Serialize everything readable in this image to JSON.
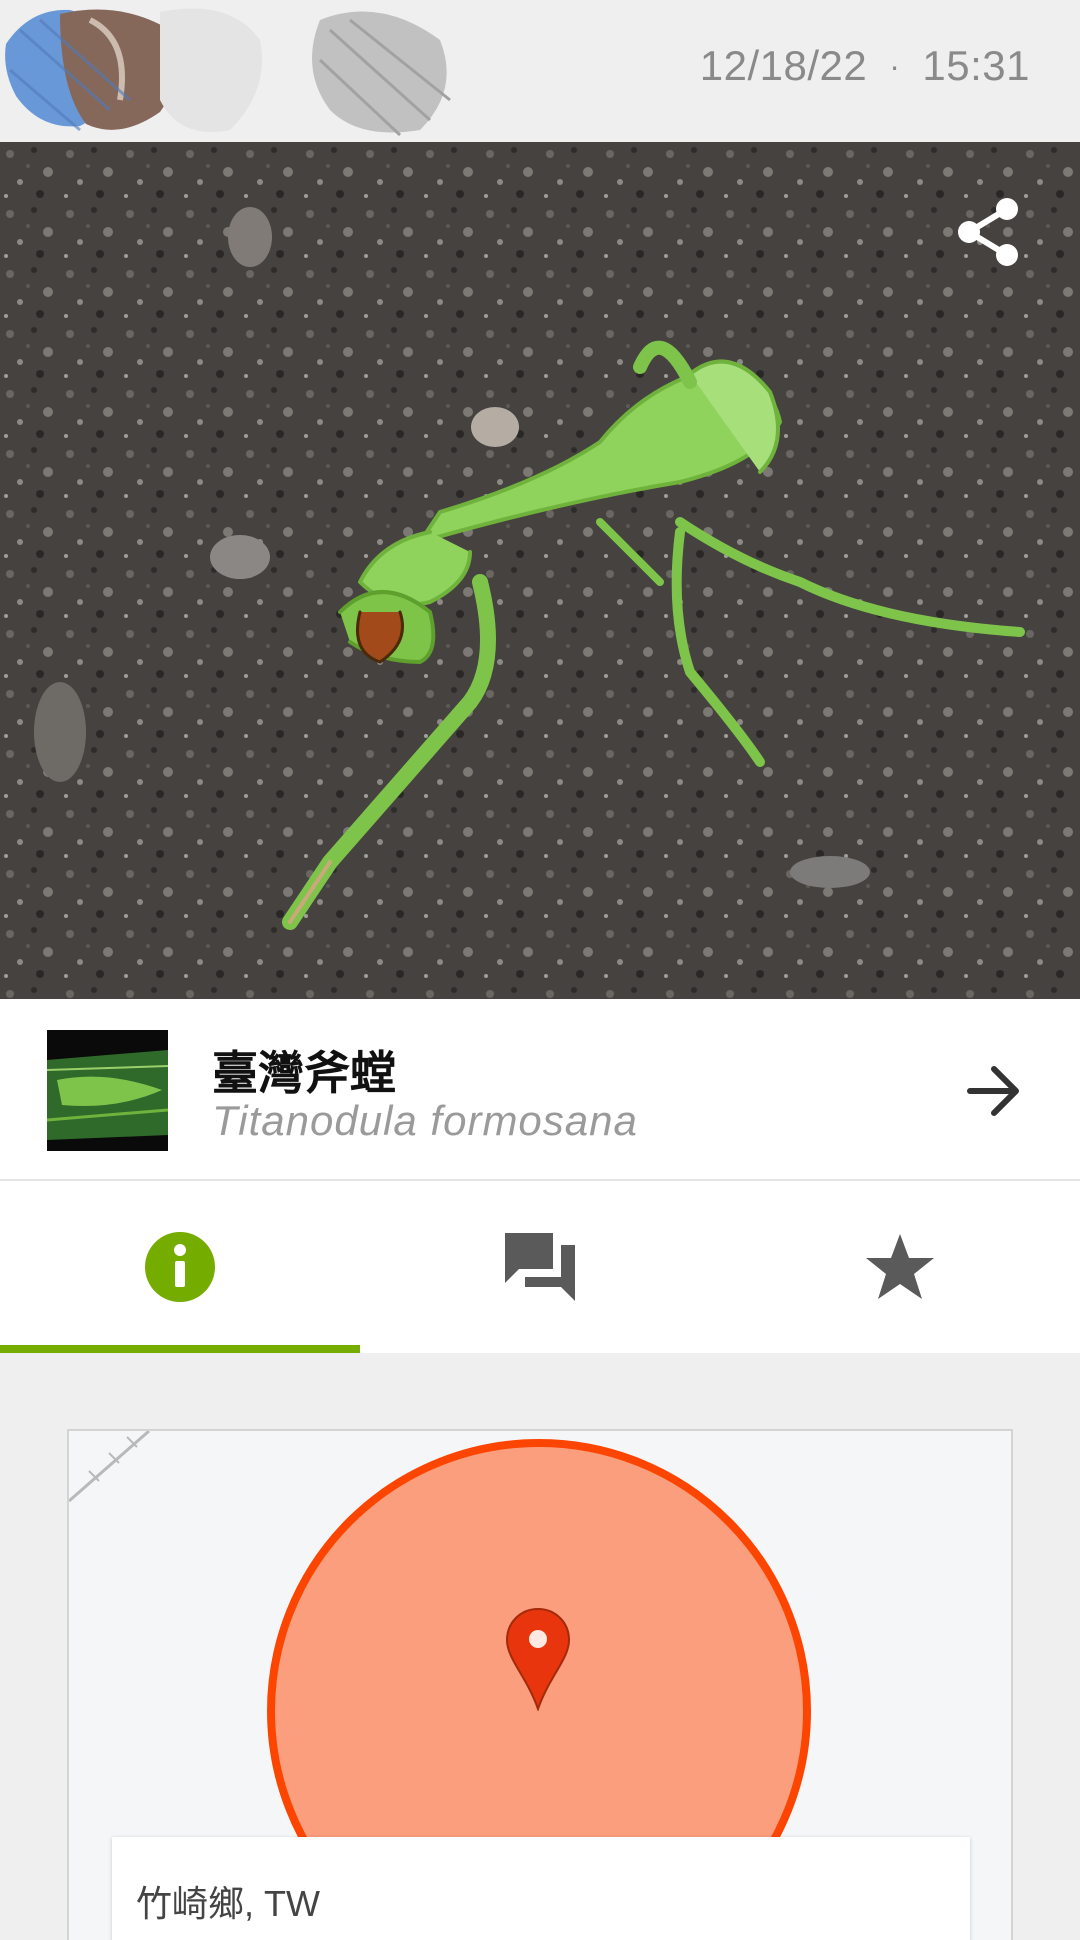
{
  "header": {
    "date": "12/18/22",
    "separator": "·",
    "time": "15:31"
  },
  "photo": {
    "subject": "green praying mantis on asphalt",
    "share_icon": "share-icon"
  },
  "taxon": {
    "common_name": "臺灣斧螳",
    "scientific_name": "Titanodula formosana",
    "arrow_icon": "arrow-right-icon"
  },
  "tabs": [
    {
      "name": "info",
      "icon": "info-icon",
      "active": true
    },
    {
      "name": "activity",
      "icon": "chat-bubbles-icon",
      "active": false
    },
    {
      "name": "favorites",
      "icon": "star-icon",
      "active": false
    }
  ],
  "map": {
    "place": "竹崎鄉, TW",
    "pin_icon": "map-pin-icon"
  },
  "colors": {
    "accent_green": "#74ac00",
    "map_circle_fill": "#fa9e7e",
    "map_circle_stroke": "#fc4500",
    "pin_red": "#e8350e"
  }
}
